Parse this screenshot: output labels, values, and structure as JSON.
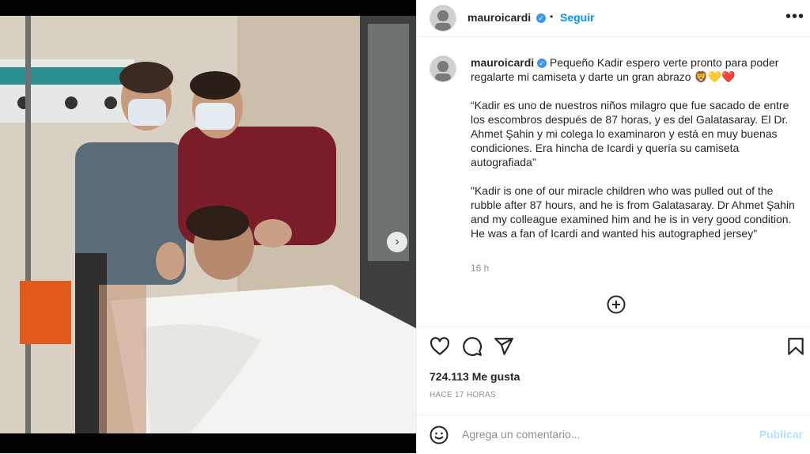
{
  "post": {
    "image_alt": "Hospital room photo with two medical staff and a boy in bed waving",
    "next_icon": "chevron-right-icon"
  },
  "header": {
    "username": "mauroicardi",
    "verified": true,
    "separator": "•",
    "follow_label": "Seguir",
    "more_icon": "more-horizontal-icon"
  },
  "caption": {
    "username": "mauroicardi",
    "line1": "Pequeño Kadir espero verte pronto para poder regalarte mi camiseta y darte un gran abrazo 🦁💛❤️",
    "para_es": "“Kadir es uno de nuestros niños milagro que fue sacado de entre los escombros después de 87 horas, y es del Galatasaray. El Dr. Ahmet Şahin y mi colega lo examinaron y está en muy buenas condiciones. Era hincha de Icardi y quería su camiseta autografiada”",
    "para_en": "\"Kadir is one of our miracle children who was pulled out of the rubble after 87 hours, and he is from Galatasaray. Dr Ahmet Şahin and my colleague examined him and he is in very good condition. He was a fan of Icardi and wanted his autographed jersey\"",
    "time": "16 h"
  },
  "actions": {
    "like_icon": "heart-icon",
    "comment_icon": "comment-icon",
    "share_icon": "send-icon",
    "save_icon": "bookmark-icon",
    "load_more_icon": "plus-circle-icon"
  },
  "likes": "724.113 Me gusta",
  "posted_ago": "HACE 17 HORAS",
  "comment": {
    "emoji_icon": "emoji-icon",
    "placeholder": "Agrega un comentario...",
    "publish_label": "Publicar"
  },
  "colors": {
    "accent": "#0095f6",
    "publish_disabled": "#b2dffc",
    "verified": "#3897f0"
  }
}
